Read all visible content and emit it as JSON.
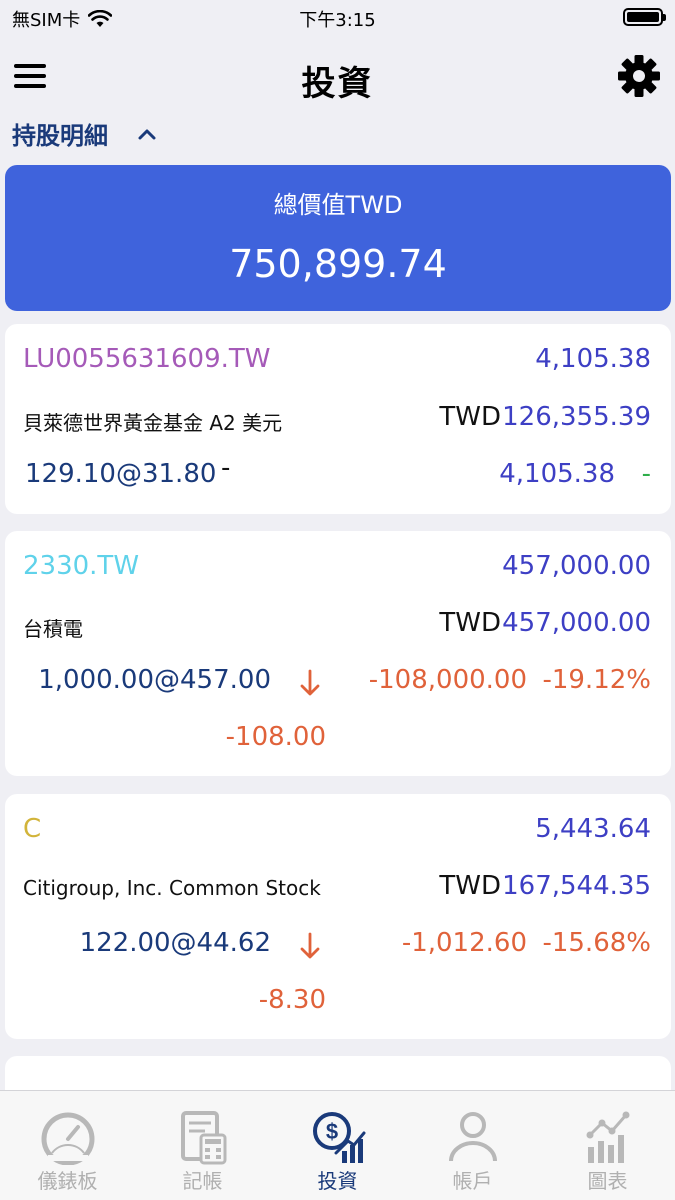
{
  "status_bar": {
    "carrier": "無SIM卡",
    "time": "下午3:15"
  },
  "nav": {
    "title": "投資"
  },
  "section": {
    "title": "持股明細"
  },
  "total": {
    "label": "總價值TWD",
    "value": "750,899.74"
  },
  "holdings": [
    {
      "ticker": "LU0055631609.TW",
      "ticker_color": "#a55ab8",
      "market_value": "4,105.38",
      "name": "貝萊德世界黃金基金 A2 美元",
      "currency": "TWD",
      "market_value_twd": "126,355.39",
      "position": "129.10@31.80",
      "change_marker": "-",
      "gain": "4,105.38",
      "gain_pct": "-"
    },
    {
      "ticker": "2330.TW",
      "ticker_color": "#5fd2ea",
      "market_value": "457,000.00",
      "name": "台積電",
      "currency": "TWD",
      "market_value_twd": "457,000.00",
      "position": "1,000.00@457.00",
      "gain": "-108,000.00",
      "gain_pct": "-19.12%",
      "day_change": "-108.00"
    },
    {
      "ticker": "C",
      "ticker_color": "#d2b43a",
      "market_value": "5,443.64",
      "name": "Citigroup, Inc. Common Stock",
      "currency": "TWD",
      "market_value_twd": "167,544.35",
      "position": "122.00@44.62",
      "gain": "-1,012.60",
      "gain_pct": "-15.68%",
      "day_change": "-8.30"
    }
  ],
  "tabs": [
    {
      "label": "儀錶板",
      "icon": "gauge-icon"
    },
    {
      "label": "記帳",
      "icon": "calculator-icon"
    },
    {
      "label": "投資",
      "icon": "investment-icon",
      "active": true
    },
    {
      "label": "帳戶",
      "icon": "person-icon"
    },
    {
      "label": "圖表",
      "icon": "chart-icon"
    }
  ],
  "colors": {
    "accent": "#3f63dc",
    "negative": "#e0623a",
    "positive": "#2eae4a",
    "dark_blue": "#1a3a7a",
    "value_blue": "#3d3fc4"
  }
}
